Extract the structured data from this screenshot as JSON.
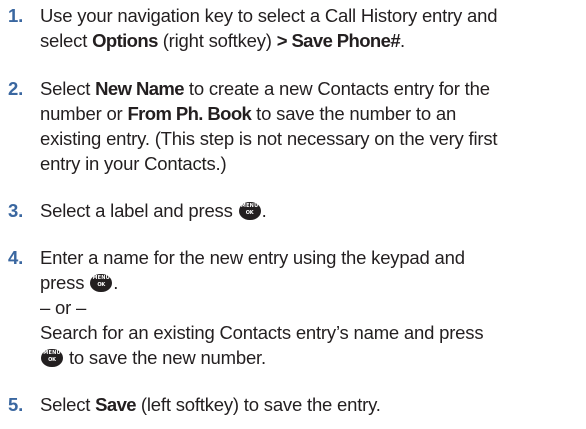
{
  "icons": {
    "menu_ok_key": {
      "name": "menu-ok-key-icon",
      "top_text": "MENU",
      "bottom_text": "OK"
    }
  },
  "steps": [
    {
      "number": "1.",
      "lines": [
        {
          "t1": "Use your navigation key to select a Call History entry and"
        },
        {
          "t1": "select ",
          "b1": "Options",
          "t2": " (right softkey) ",
          "b2": "> Save Phone#",
          "t3": "."
        }
      ]
    },
    {
      "number": "2.",
      "lines": [
        {
          "t1": "Select ",
          "b1": "New Name",
          "t2": " to create a new Contacts entry for the"
        },
        {
          "t1": "number or ",
          "b1": "From Ph. Book",
          "t2": " to save the number to an"
        },
        {
          "t1": "existing entry. (This step is not necessary on the very first"
        },
        {
          "t1": "entry in your Contacts.)"
        }
      ]
    },
    {
      "number": "3.",
      "lines": [
        {
          "t1": "Select a label and press ",
          "t2": "."
        }
      ]
    },
    {
      "number": "4.",
      "lines": [
        {
          "t1": "Enter a name for the new entry using the keypad and"
        },
        {
          "t1": "press ",
          "t2": "."
        },
        {
          "t1": "– or –"
        },
        {
          "t1": "Search for an existing Contacts entry’s name and press"
        },
        {
          "t1": " to save the new number."
        }
      ]
    },
    {
      "number": "5.",
      "lines": [
        {
          "t1": "Select ",
          "b1": "Save",
          "t2": " (left softkey) to save the entry."
        }
      ]
    }
  ]
}
